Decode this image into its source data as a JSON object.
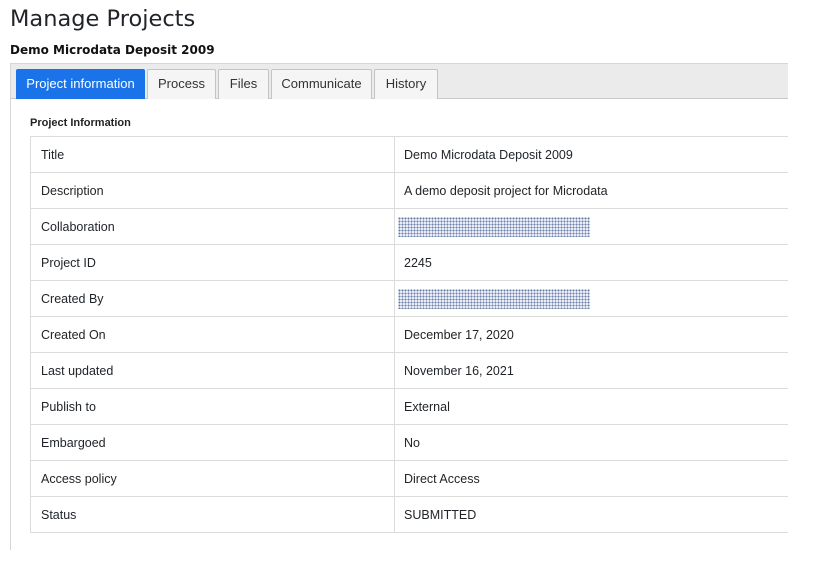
{
  "page": {
    "title": "Manage Projects",
    "project_name": "Demo Microdata Deposit 2009"
  },
  "tabs": [
    {
      "label": "Project information",
      "active": true
    },
    {
      "label": "Process",
      "active": false
    },
    {
      "label": "Files",
      "active": false
    },
    {
      "label": "Communicate",
      "active": false
    },
    {
      "label": "History",
      "active": false
    }
  ],
  "section": {
    "label": "Project Information"
  },
  "rows": [
    {
      "label": "Title",
      "value": "Demo Microdata Deposit 2009",
      "redacted": false
    },
    {
      "label": "Description",
      "value": "A demo deposit project for Microdata",
      "redacted": false
    },
    {
      "label": "Collaboration",
      "value": "",
      "redacted": true
    },
    {
      "label": "Project ID",
      "value": "2245",
      "redacted": false
    },
    {
      "label": "Created By",
      "value": "",
      "redacted": true
    },
    {
      "label": "Created On",
      "value": "December 17, 2020",
      "redacted": false
    },
    {
      "label": "Last updated",
      "value": "November 16, 2021",
      "redacted": false
    },
    {
      "label": "Publish to",
      "value": "External",
      "redacted": false
    },
    {
      "label": "Embargoed",
      "value": "No",
      "redacted": false
    },
    {
      "label": "Access policy",
      "value": "Direct Access",
      "redacted": false
    },
    {
      "label": "Status",
      "value": "SUBMITTED",
      "redacted": false
    }
  ],
  "colors": {
    "active_tab": "#1a73e8",
    "tab_bar": "#ebebeb",
    "border": "#dcdcdc"
  }
}
